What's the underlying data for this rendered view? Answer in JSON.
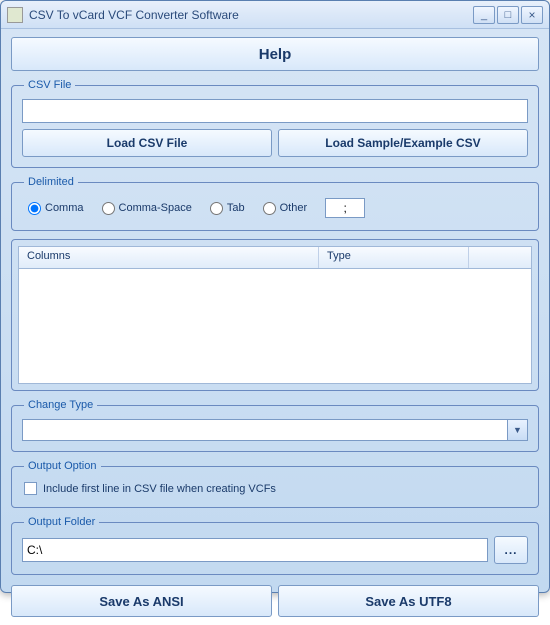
{
  "window": {
    "title": "CSV To vCard VCF Converter Software"
  },
  "help_button": "Help",
  "csv_file": {
    "legend": "CSV File",
    "path": "",
    "load_csv": "Load CSV File",
    "load_sample": "Load Sample/Example CSV"
  },
  "delimited": {
    "legend": "Delimited",
    "options": {
      "comma": "Comma",
      "comma_space": "Comma-Space",
      "tab": "Tab",
      "other": "Other"
    },
    "selected": "comma",
    "other_value": ";"
  },
  "columns_table": {
    "headers": {
      "columns": "Columns",
      "type": "Type"
    },
    "rows": []
  },
  "change_type": {
    "legend": "Change Type",
    "selected": ""
  },
  "output_option": {
    "legend": "Output Option",
    "include_first_line": "Include first line in CSV file when creating VCFs",
    "checked": false
  },
  "output_folder": {
    "legend": "Output Folder",
    "path": "C:\\",
    "browse": "..."
  },
  "save": {
    "ansi": "Save As ANSI",
    "utf8": "Save As UTF8"
  }
}
